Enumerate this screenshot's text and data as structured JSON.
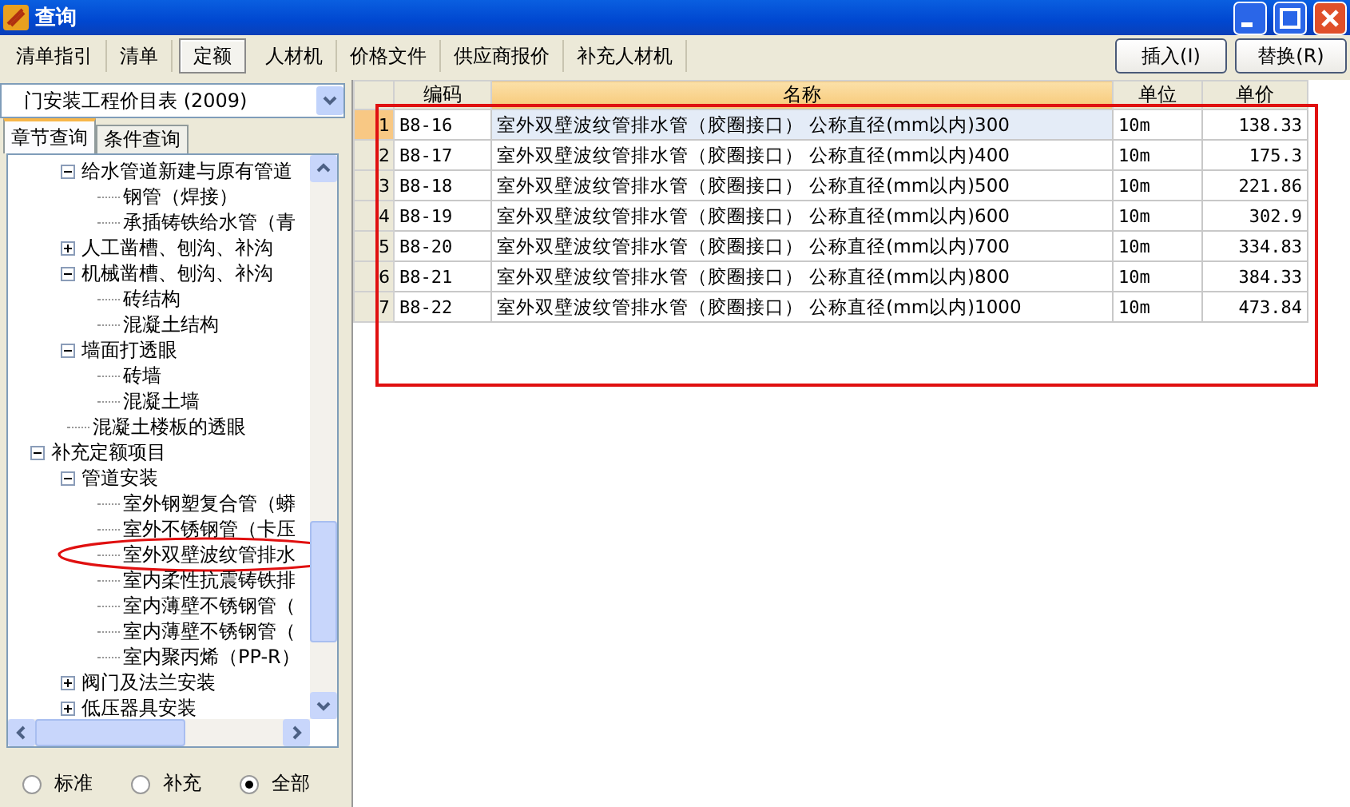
{
  "window": {
    "title": "查询"
  },
  "tabs": [
    {
      "label": "清单指引",
      "selected": false
    },
    {
      "label": "清单",
      "selected": false
    },
    {
      "label": "定额",
      "selected": true
    },
    {
      "label": "人材机",
      "selected": false
    },
    {
      "label": "价格文件",
      "selected": false
    },
    {
      "label": "供应商报价",
      "selected": false
    },
    {
      "label": "补充人材机",
      "selected": false
    }
  ],
  "actions": [
    "插入(I)",
    "替换(R)"
  ],
  "catalog": {
    "value": "门安装工程价目表 (2009)"
  },
  "search_tabs": [
    {
      "label": "章节查询",
      "selected": true
    },
    {
      "label": "条件查询",
      "selected": false
    }
  ],
  "tree": [
    {
      "children": [
        {
          "label": "给水管道新建与原有管道",
          "expanded": true,
          "children": [
            {
              "label": "钢管（焊接）"
            },
            {
              "label": "承插铸铁给水管（青"
            }
          ]
        },
        {
          "label": "人工凿槽、刨沟、补沟",
          "expanded": false
        },
        {
          "label": "机械凿槽、刨沟、补沟",
          "expanded": true,
          "children": [
            {
              "label": "砖结构"
            },
            {
              "label": "混凝土结构"
            }
          ]
        },
        {
          "label": "墙面打透眼",
          "expanded": true,
          "children": [
            {
              "label": "砖墙"
            },
            {
              "label": "混凝土墙"
            }
          ]
        },
        {
          "label": "混凝土楼板的透眼"
        }
      ]
    },
    {
      "label": "补充定额项目",
      "expanded": true,
      "children": [
        {
          "label": "管道安装",
          "expanded": true,
          "children": [
            {
              "label": "室外钢塑复合管（蟒"
            },
            {
              "label": "室外不锈钢管（卡压"
            },
            {
              "label": "室外双壁波纹管排水",
              "circled": true
            },
            {
              "label": "室内柔性抗震铸铁排"
            },
            {
              "label": "室内薄壁不锈钢管（"
            },
            {
              "label": "室内薄壁不锈钢管（"
            },
            {
              "label": "室内聚丙烯（PP-R）"
            }
          ]
        },
        {
          "label": "阀门及法兰安装",
          "expanded": false
        },
        {
          "label": "低压器具安装",
          "expanded": false
        }
      ]
    }
  ],
  "filters": [
    {
      "label": "标准",
      "selected": false
    },
    {
      "label": "补充",
      "selected": false
    },
    {
      "label": "全部",
      "selected": true
    }
  ],
  "table": {
    "circled": true,
    "columns": [
      {
        "label": "编码",
        "sorted": false
      },
      {
        "label": "名称",
        "sorted": true
      },
      {
        "label": "单位",
        "sorted": false
      },
      {
        "label": "单价",
        "sorted": false
      }
    ],
    "rows": [
      {
        "num": "1",
        "code": "B8-16",
        "name": "室外双壁波纹管排水管（胶圈接口） 公称直径(mm以内)300",
        "unit": "10m",
        "price": "138.33",
        "selected": true
      },
      {
        "num": "2",
        "code": "B8-17",
        "name": "室外双壁波纹管排水管（胶圈接口） 公称直径(mm以内)400",
        "unit": "10m",
        "price": "175.3",
        "selected": false
      },
      {
        "num": "3",
        "code": "B8-18",
        "name": "室外双壁波纹管排水管（胶圈接口） 公称直径(mm以内)500",
        "unit": "10m",
        "price": "221.86",
        "selected": false
      },
      {
        "num": "4",
        "code": "B8-19",
        "name": "室外双壁波纹管排水管（胶圈接口） 公称直径(mm以内)600",
        "unit": "10m",
        "price": "302.9",
        "selected": false
      },
      {
        "num": "5",
        "code": "B8-20",
        "name": "室外双壁波纹管排水管（胶圈接口） 公称直径(mm以内)700",
        "unit": "10m",
        "price": "334.83",
        "selected": false
      },
      {
        "num": "6",
        "code": "B8-21",
        "name": "室外双壁波纹管排水管（胶圈接口） 公称直径(mm以内)800",
        "unit": "10m",
        "price": "384.33",
        "selected": false
      },
      {
        "num": "7",
        "code": "B8-22",
        "name": "室外双壁波纹管排水管（胶圈接口） 公称直径(mm以内)1000",
        "unit": "10m",
        "price": "473.84",
        "selected": false
      }
    ]
  }
}
